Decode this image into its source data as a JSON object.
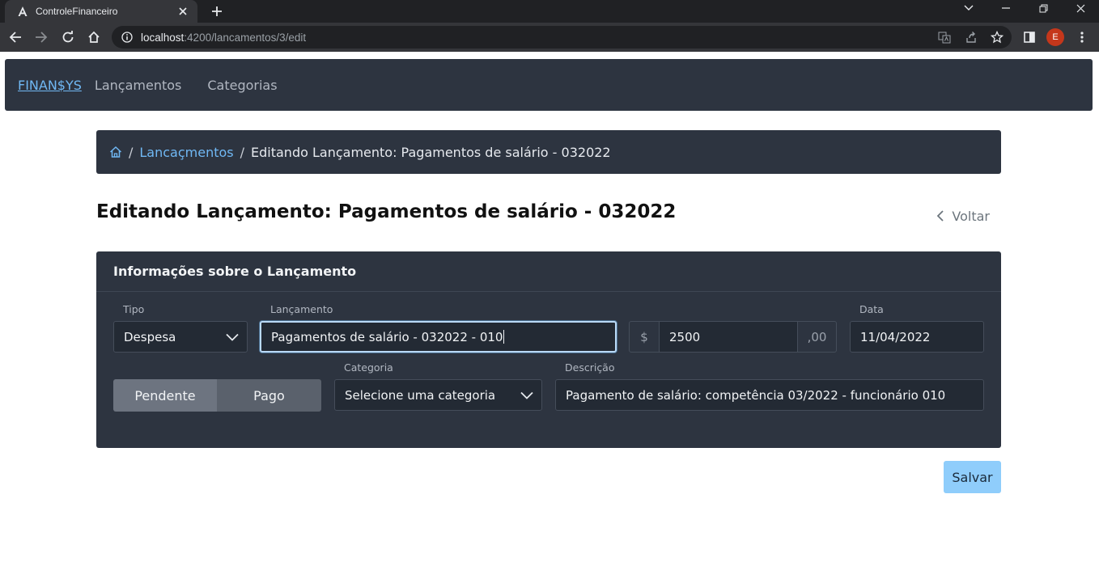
{
  "browser": {
    "tab_title": "ControleFinanceiro",
    "url_host": "localhost",
    "url_path": ":4200/lancamentos/3/edit",
    "profile_initial": "E"
  },
  "navbar": {
    "brand": "FINAN$YS",
    "links": [
      "Lançamentos",
      "Categorias"
    ]
  },
  "breadcrumb": {
    "home_icon": "home-icon",
    "link": "Lancaçmentos",
    "active": "Editando Lançamento: Pagamentos de salário - 032022"
  },
  "page": {
    "title": "Editando Lançamento: Pagamentos de salário - 032022",
    "back_label": "Voltar"
  },
  "form": {
    "card_title": "Informações sobre o Lançamento",
    "tipo": {
      "label": "Tipo",
      "value": "Despesa"
    },
    "lancamento": {
      "label": "Lançamento",
      "value": "Pagamentos de salário - 032022 - 010"
    },
    "valor": {
      "prefix": "$",
      "value": "2500",
      "suffix": ",00"
    },
    "data": {
      "label": "Data",
      "value": "11/04/2022"
    },
    "status": {
      "pendente": "Pendente",
      "pago": "Pago",
      "selected": "Pendente"
    },
    "categoria": {
      "label": "Categoria",
      "value": "Selecione uma categoria"
    },
    "descricao": {
      "label": "Descrição",
      "value": "Pagamento de salário: competência 03/2022 - funcionário 010"
    },
    "save_label": "Salvar"
  },
  "colors": {
    "panel": "#2d3440",
    "link": "#70b8f4",
    "save_button": "#8fcdfb"
  }
}
